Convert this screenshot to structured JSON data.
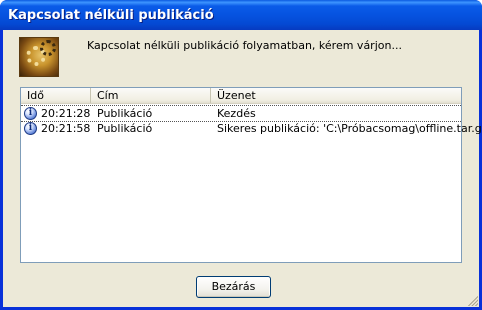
{
  "window": {
    "title": "Kapcsolat nélküli publikáció"
  },
  "banner": {
    "message": "Kapcsolat nélküli publikáció folyamatban, kérem várjon..."
  },
  "log": {
    "columns": [
      "Idő",
      "Cím",
      "Üzenet"
    ],
    "rows": [
      {
        "time": "20:21:28",
        "title": "Publikáció",
        "message": "Kezdés",
        "icon": "info-icon"
      },
      {
        "time": "20:21:58",
        "title": "Publikáció",
        "message": "Sikeres publikáció: 'C:\\Próbacsomag\\offline.tar.gz'",
        "icon": "info-icon"
      }
    ]
  },
  "buttons": {
    "close_label": "Bezárás"
  },
  "colors": {
    "titlebar": "#0653e0",
    "face": "#ece9d8",
    "list_border": "#7f9db9"
  }
}
